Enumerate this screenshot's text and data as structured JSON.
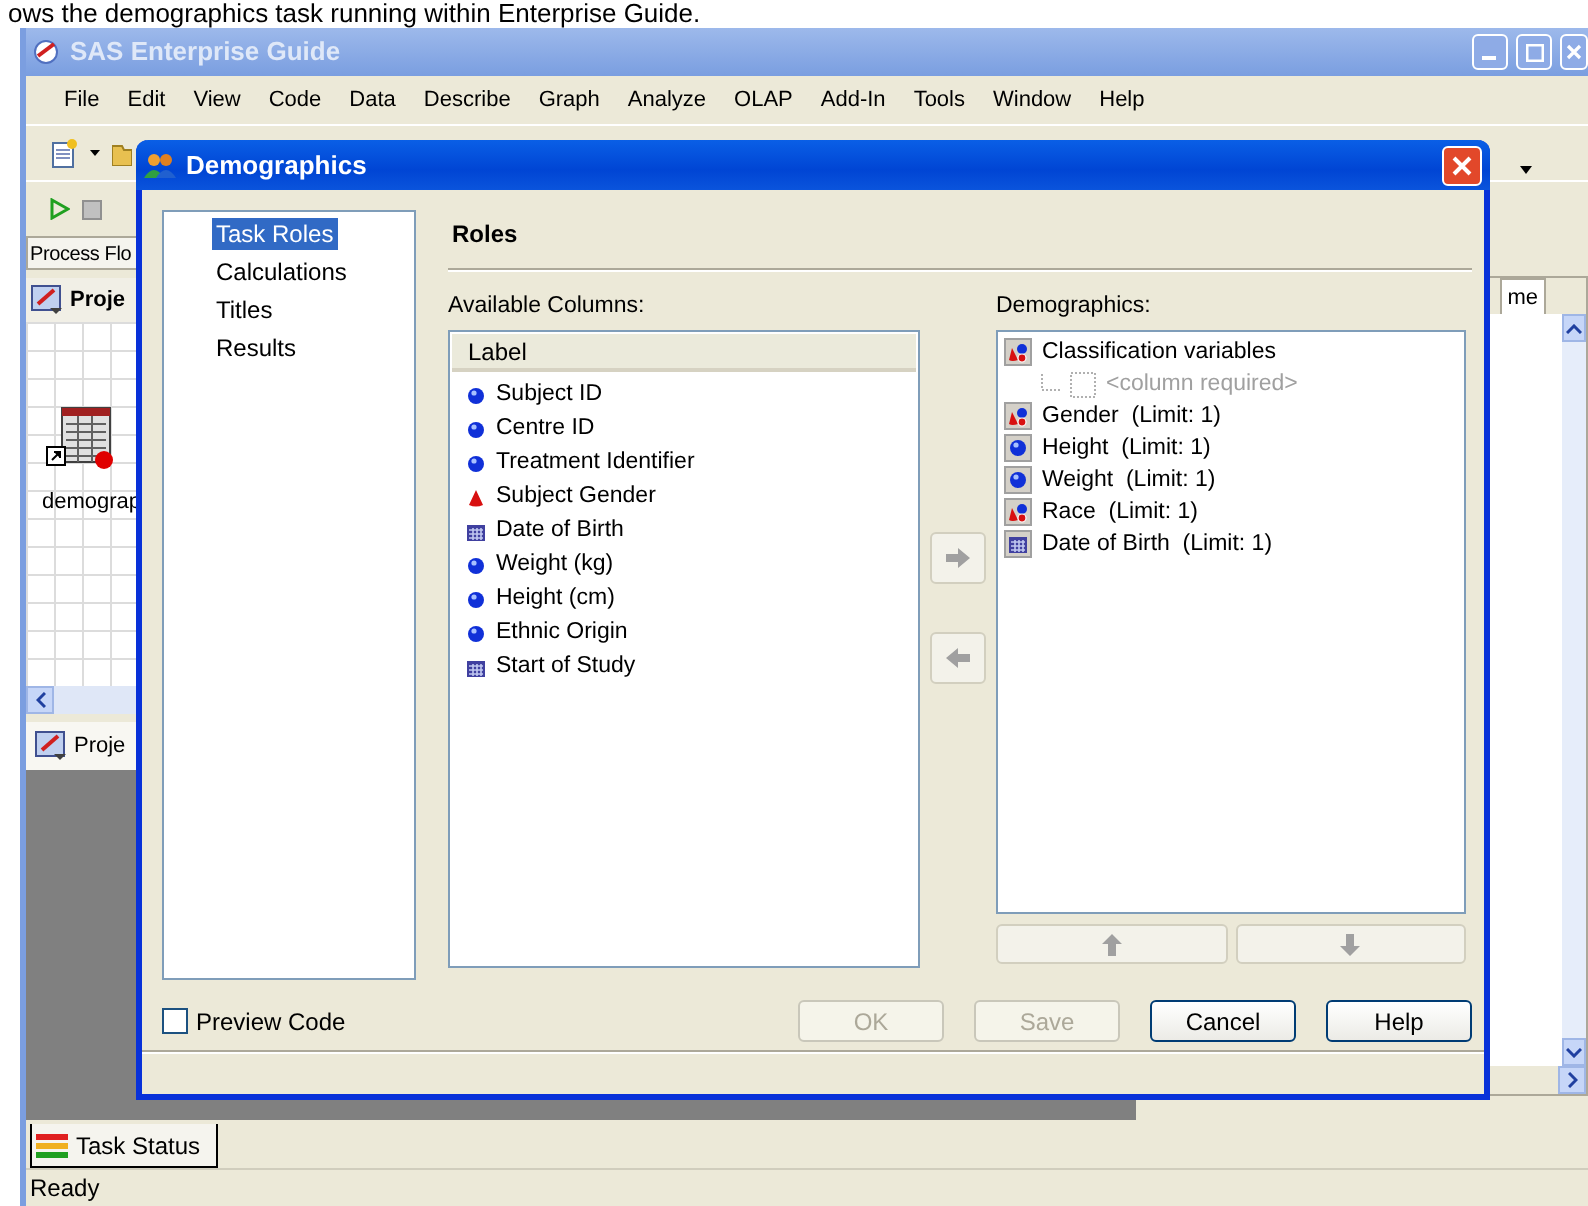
{
  "caption": "ows the demographics task running within Enterprise Guide.",
  "app": {
    "title": "SAS Enterprise Guide",
    "menu": [
      "File",
      "Edit",
      "View",
      "Code",
      "Data",
      "Describe",
      "Graph",
      "Analyze",
      "OLAP",
      "Add-In",
      "Tools",
      "Window",
      "Help"
    ],
    "left_pane": {
      "header": "Process Flo",
      "tab": "Proje",
      "node_label": "demograp",
      "bottom_tab": "Proje"
    },
    "right_pane": {
      "tab": "me"
    },
    "bottom_tab": "Task Status",
    "status": "Ready"
  },
  "dialog": {
    "title": "Demographics",
    "nav": [
      {
        "label": "Task Roles",
        "selected": true
      },
      {
        "label": "Calculations",
        "selected": false
      },
      {
        "label": "Titles",
        "selected": false
      },
      {
        "label": "Results",
        "selected": false
      }
    ],
    "section_title": "Roles",
    "available": {
      "label": "Available Columns:",
      "header": "Label",
      "items": [
        {
          "name": "Subject ID",
          "kind": "numeric"
        },
        {
          "name": "Centre ID",
          "kind": "numeric"
        },
        {
          "name": "Treatment Identifier",
          "kind": "numeric"
        },
        {
          "name": "Subject Gender",
          "kind": "character"
        },
        {
          "name": "Date of Birth",
          "kind": "date"
        },
        {
          "name": "Weight (kg)",
          "kind": "numeric"
        },
        {
          "name": "Height (cm)",
          "kind": "numeric"
        },
        {
          "name": "Ethnic Origin",
          "kind": "numeric"
        },
        {
          "name": "Start of Study",
          "kind": "date"
        }
      ]
    },
    "roles": {
      "label": "Demographics:",
      "items": [
        {
          "label": "Classification variables",
          "kind": "classification",
          "children": [
            {
              "label": "<column required>",
              "kind": "placeholder"
            }
          ]
        },
        {
          "label": "Gender  (Limit: 1)",
          "kind": "classification"
        },
        {
          "label": "Height  (Limit: 1)",
          "kind": "numeric"
        },
        {
          "label": "Weight  (Limit: 1)",
          "kind": "numeric"
        },
        {
          "label": "Race  (Limit: 1)",
          "kind": "classification"
        },
        {
          "label": "Date of Birth  (Limit: 1)",
          "kind": "date"
        }
      ]
    },
    "preview_code": {
      "label": "Preview Code",
      "checked": false
    },
    "buttons": [
      {
        "label": "OK",
        "disabled": true
      },
      {
        "label": "Save",
        "disabled": true
      },
      {
        "label": "Cancel",
        "disabled": false
      },
      {
        "label": "Help",
        "disabled": false
      }
    ]
  }
}
